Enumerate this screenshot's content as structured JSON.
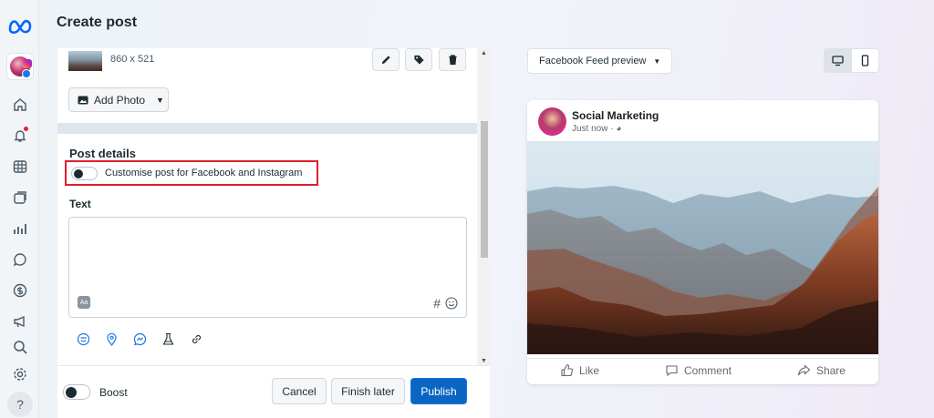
{
  "page": {
    "title": "Create post"
  },
  "nav": {
    "items": [
      "home",
      "notifications",
      "planner",
      "content",
      "insights",
      "inbox",
      "monetization",
      "ads",
      "search",
      "settings"
    ],
    "help_label": "?"
  },
  "media": {
    "dimensions": "860 x 521",
    "add_photo_label": "Add Photo"
  },
  "details": {
    "title": "Post details",
    "customise_label": "Customise post for Facebook and Instagram",
    "text_label": "Text",
    "text_value": "",
    "aa_label": "Aa",
    "hash": "#"
  },
  "footer": {
    "boost_label": "Boost",
    "cancel_label": "Cancel",
    "finish_later_label": "Finish later",
    "publish_label": "Publish"
  },
  "preview": {
    "select_label": "Facebook Feed preview",
    "page_name": "Social Marketing",
    "time": "Just now · ",
    "like_label": "Like",
    "comment_label": "Comment",
    "share_label": "Share"
  },
  "colors": {
    "accent": "#0a66c2",
    "highlight_border": "#e0202a"
  }
}
